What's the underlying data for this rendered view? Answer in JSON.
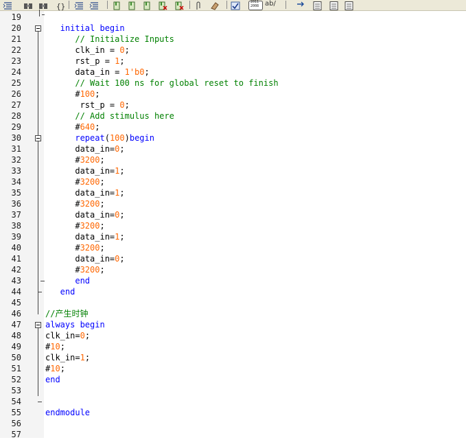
{
  "toolbar": {
    "icons": [
      "align-icon",
      "find-icon",
      "replace-icon",
      "brace-icon",
      "indent-icon",
      "outdent-icon",
      "bookmark-icon",
      "bookmark-next-icon",
      "bookmark-prev-icon",
      "bookmark-clear-icon",
      "bookmark-clear-all-icon",
      "attach-icon",
      "eraser-icon",
      "check-icon",
      "binary-icon",
      "spell-icon",
      "arrow-icon",
      "page-icon",
      "page-prev-icon",
      "page-next-icon"
    ],
    "binary_label": "2011\n2008",
    "spell_label": "ab/"
  },
  "editor": {
    "lines": [
      {
        "n": "19",
        "segs": []
      },
      {
        "n": "20",
        "segs": [
          {
            "t": "   initial begin",
            "c": "kw"
          }
        ]
      },
      {
        "n": "21",
        "segs": [
          {
            "t": "      // Initialize Inputs",
            "c": "cmt"
          }
        ]
      },
      {
        "n": "22",
        "segs": [
          {
            "t": "      clk_in = ",
            "c": "id"
          },
          {
            "t": "0",
            "c": "num"
          },
          {
            "t": ";",
            "c": "id"
          }
        ]
      },
      {
        "n": "23",
        "segs": [
          {
            "t": "      rst_p = ",
            "c": "id"
          },
          {
            "t": "1",
            "c": "num"
          },
          {
            "t": ";",
            "c": "id"
          }
        ]
      },
      {
        "n": "24",
        "segs": [
          {
            "t": "      data_in = ",
            "c": "id"
          },
          {
            "t": "1'b0",
            "c": "num"
          },
          {
            "t": ";",
            "c": "id"
          }
        ]
      },
      {
        "n": "25",
        "segs": [
          {
            "t": "      // Wait 100 ns for global reset to finish",
            "c": "cmt"
          }
        ]
      },
      {
        "n": "26",
        "segs": [
          {
            "t": "      #",
            "c": "id"
          },
          {
            "t": "100",
            "c": "num"
          },
          {
            "t": ";",
            "c": "id"
          }
        ]
      },
      {
        "n": "27",
        "segs": [
          {
            "t": "       rst_p = ",
            "c": "id"
          },
          {
            "t": "0",
            "c": "num"
          },
          {
            "t": ";",
            "c": "id"
          }
        ]
      },
      {
        "n": "28",
        "segs": [
          {
            "t": "      // Add stimulus here",
            "c": "cmt"
          }
        ]
      },
      {
        "n": "29",
        "segs": [
          {
            "t": "      #",
            "c": "id"
          },
          {
            "t": "640",
            "c": "num"
          },
          {
            "t": ";",
            "c": "id"
          }
        ]
      },
      {
        "n": "30",
        "segs": [
          {
            "t": "      repeat",
            "c": "kw"
          },
          {
            "t": "(",
            "c": "id"
          },
          {
            "t": "100",
            "c": "num"
          },
          {
            "t": ")",
            "c": "id"
          },
          {
            "t": "begin",
            "c": "kw"
          }
        ]
      },
      {
        "n": "31",
        "segs": [
          {
            "t": "      data_in=",
            "c": "id"
          },
          {
            "t": "0",
            "c": "num"
          },
          {
            "t": ";",
            "c": "id"
          }
        ]
      },
      {
        "n": "32",
        "segs": [
          {
            "t": "      #",
            "c": "id"
          },
          {
            "t": "3200",
            "c": "num"
          },
          {
            "t": ";",
            "c": "id"
          }
        ]
      },
      {
        "n": "33",
        "segs": [
          {
            "t": "      data_in=",
            "c": "id"
          },
          {
            "t": "1",
            "c": "num"
          },
          {
            "t": ";",
            "c": "id"
          }
        ]
      },
      {
        "n": "34",
        "segs": [
          {
            "t": "      #",
            "c": "id"
          },
          {
            "t": "3200",
            "c": "num"
          },
          {
            "t": ";",
            "c": "id"
          }
        ]
      },
      {
        "n": "35",
        "segs": [
          {
            "t": "      data_in=",
            "c": "id"
          },
          {
            "t": "1",
            "c": "num"
          },
          {
            "t": ";",
            "c": "id"
          }
        ]
      },
      {
        "n": "36",
        "segs": [
          {
            "t": "      #",
            "c": "id"
          },
          {
            "t": "3200",
            "c": "num"
          },
          {
            "t": ";",
            "c": "id"
          }
        ]
      },
      {
        "n": "37",
        "segs": [
          {
            "t": "      data_in=",
            "c": "id"
          },
          {
            "t": "0",
            "c": "num"
          },
          {
            "t": ";",
            "c": "id"
          }
        ]
      },
      {
        "n": "38",
        "segs": [
          {
            "t": "      #",
            "c": "id"
          },
          {
            "t": "3200",
            "c": "num"
          },
          {
            "t": ";",
            "c": "id"
          }
        ]
      },
      {
        "n": "39",
        "segs": [
          {
            "t": "      data_in=",
            "c": "id"
          },
          {
            "t": "1",
            "c": "num"
          },
          {
            "t": ";",
            "c": "id"
          }
        ]
      },
      {
        "n": "40",
        "segs": [
          {
            "t": "      #",
            "c": "id"
          },
          {
            "t": "3200",
            "c": "num"
          },
          {
            "t": ";",
            "c": "id"
          }
        ]
      },
      {
        "n": "41",
        "segs": [
          {
            "t": "      data_in=",
            "c": "id"
          },
          {
            "t": "0",
            "c": "num"
          },
          {
            "t": ";",
            "c": "id"
          }
        ]
      },
      {
        "n": "42",
        "segs": [
          {
            "t": "      #",
            "c": "id"
          },
          {
            "t": "3200",
            "c": "num"
          },
          {
            "t": ";",
            "c": "id"
          }
        ]
      },
      {
        "n": "43",
        "segs": [
          {
            "t": "      end",
            "c": "kw"
          }
        ]
      },
      {
        "n": "44",
        "segs": [
          {
            "t": "   end",
            "c": "kw"
          }
        ]
      },
      {
        "n": "45",
        "segs": []
      },
      {
        "n": "46",
        "segs": [
          {
            "t": "//产生时钟",
            "c": "cmt"
          }
        ]
      },
      {
        "n": "47",
        "segs": [
          {
            "t": "always begin",
            "c": "kw"
          }
        ]
      },
      {
        "n": "48",
        "segs": [
          {
            "t": "clk_in=",
            "c": "id"
          },
          {
            "t": "0",
            "c": "num"
          },
          {
            "t": ";",
            "c": "id"
          }
        ]
      },
      {
        "n": "49",
        "segs": [
          {
            "t": "#",
            "c": "id"
          },
          {
            "t": "10",
            "c": "num"
          },
          {
            "t": ";",
            "c": "id"
          }
        ]
      },
      {
        "n": "50",
        "segs": [
          {
            "t": "clk_in=",
            "c": "id"
          },
          {
            "t": "1",
            "c": "num"
          },
          {
            "t": ";",
            "c": "id"
          }
        ]
      },
      {
        "n": "51",
        "segs": [
          {
            "t": "#",
            "c": "id"
          },
          {
            "t": "10",
            "c": "num"
          },
          {
            "t": ";",
            "c": "id"
          }
        ]
      },
      {
        "n": "52",
        "segs": [
          {
            "t": "end",
            "c": "kw"
          }
        ]
      },
      {
        "n": "53",
        "segs": []
      },
      {
        "n": "54",
        "segs": []
      },
      {
        "n": "55",
        "segs": [
          {
            "t": "endmodule",
            "c": "kw"
          }
        ]
      },
      {
        "n": "56",
        "segs": []
      },
      {
        "n": "57",
        "segs": []
      }
    ]
  }
}
